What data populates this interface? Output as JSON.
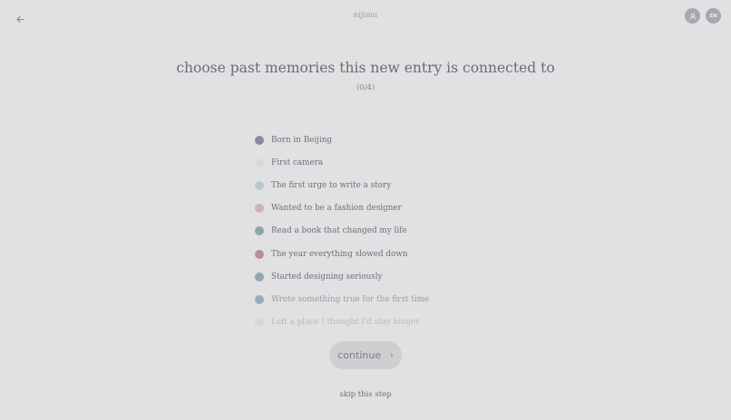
{
  "header": {
    "brand": "nijimu",
    "back_icon": "arrow-left-icon",
    "profile_icon": "person-icon",
    "language_label": "EN"
  },
  "main": {
    "title": "choose past memories this new entry is connected to",
    "counter": "(0/4)",
    "memories": [
      {
        "label": "Born in Beijing",
        "color": "#8a8a9c"
      },
      {
        "label": "First camera",
        "color": "#d9d9dc"
      },
      {
        "label": "The first urge to write a story",
        "color": "#bac6d0"
      },
      {
        "label": "Wanted to be a fashion designer",
        "color": "#cbb2b6"
      },
      {
        "label": "Read a book that changed my life",
        "color": "#8ea6aa"
      },
      {
        "label": "The year everything slowed down",
        "color": "#b88e95"
      },
      {
        "label": "Started designing seriously",
        "color": "#96a5b4"
      },
      {
        "label": "Wrote something true for the first time",
        "color": "#9aaabb"
      },
      {
        "label": "Left a place I thought I'd stay longer",
        "color": "#c6c6ca"
      }
    ],
    "continue_label": "continue",
    "continue_icon": "chevron-right-icon",
    "skip_label": "skip this step"
  }
}
